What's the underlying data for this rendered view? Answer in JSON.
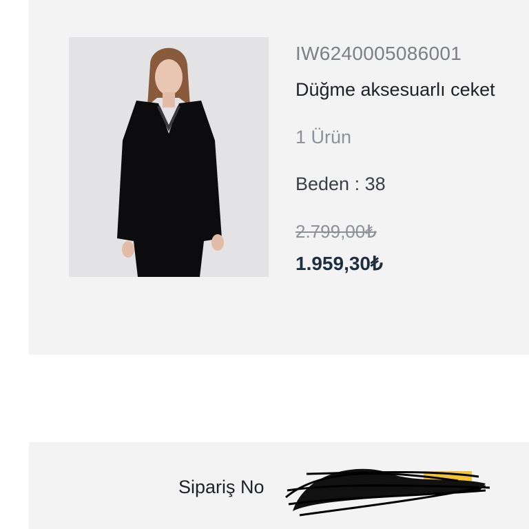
{
  "product": {
    "sku": "IW6240005086001",
    "name": "Düğme aksesuarlı ceket",
    "quantity": "1 Ürün",
    "size": "Beden : 38",
    "old_price": "2.799,00₺",
    "price": "1.959,30₺",
    "image_alt": "product-photo"
  },
  "order": {
    "label": "Sipariş No"
  },
  "colors": {
    "card_background": "#f3f3f4",
    "price_color": "#1d2e40",
    "muted_text": "#8d9096"
  }
}
